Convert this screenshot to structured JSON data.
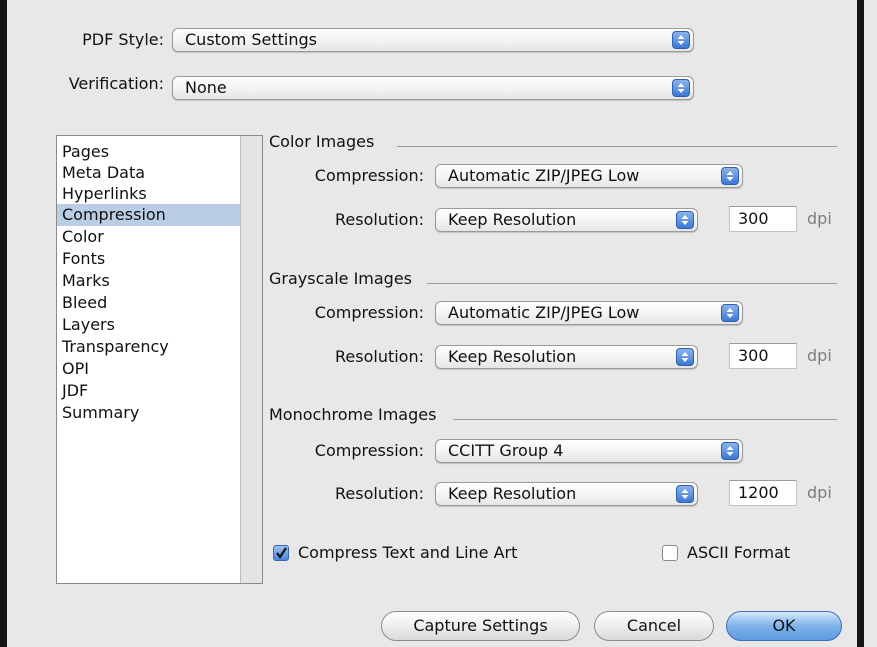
{
  "header": {
    "pdf_style_label": "PDF Style:",
    "pdf_style_value": "Custom Settings",
    "verification_label": "Verification:",
    "verification_value": "None"
  },
  "sidebar": {
    "items": [
      {
        "label": "Pages"
      },
      {
        "label": "Meta Data"
      },
      {
        "label": "Hyperlinks"
      },
      {
        "label": "Compression",
        "selected": true
      },
      {
        "label": "Color"
      },
      {
        "label": "Fonts"
      },
      {
        "label": "Marks"
      },
      {
        "label": "Bleed"
      },
      {
        "label": "Layers"
      },
      {
        "label": "Transparency"
      },
      {
        "label": "OPI"
      },
      {
        "label": "JDF"
      },
      {
        "label": "Summary"
      }
    ]
  },
  "sections": {
    "color": {
      "title": "Color Images",
      "compression_label": "Compression:",
      "compression_value": "Automatic ZIP/JPEG Low",
      "resolution_label": "Resolution:",
      "resolution_value": "Keep Resolution",
      "dpi_value": "300",
      "dpi_unit": "dpi"
    },
    "grayscale": {
      "title": "Grayscale Images",
      "compression_label": "Compression:",
      "compression_value": "Automatic ZIP/JPEG Low",
      "resolution_label": "Resolution:",
      "resolution_value": "Keep Resolution",
      "dpi_value": "300",
      "dpi_unit": "dpi"
    },
    "monochrome": {
      "title": "Monochrome Images",
      "compression_label": "Compression:",
      "compression_value": "CCITT Group 4",
      "resolution_label": "Resolution:",
      "resolution_value": "Keep Resolution",
      "dpi_value": "1200",
      "dpi_unit": "dpi"
    }
  },
  "options": {
    "compress_text_label": "Compress Text and Line Art",
    "compress_text_checked": true,
    "ascii_format_label": "ASCII Format",
    "ascii_format_checked": false
  },
  "buttons": {
    "capture_settings": "Capture Settings",
    "cancel": "Cancel",
    "ok": "OK"
  },
  "colors": {
    "selection": "#b9cde4",
    "accent": "#5d9be2"
  }
}
